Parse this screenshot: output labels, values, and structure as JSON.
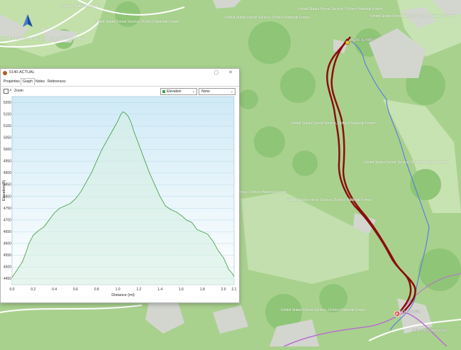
{
  "map": {
    "labels": [
      "United States Forest Service, Ochoco National Forest",
      "United States Forest Service, Ochoco National Forest",
      "United States Forest Service, Ochoco National Forest",
      "United States Forest Service, Ochoco National Forest",
      "United States Forest Service, Ochoco National Forest",
      "United States Forest Service, Ochoco National Forest",
      "United States Forest Service, Ochoco National Forest",
      "United States Forest Service, Ochoco National Forest",
      "ervice, Ochoco National Forest",
      "United States Forest Service, Ochoco National Forest",
      "Ochoco National Forest",
      "United States Forest Service, Ochoco National Forest"
    ],
    "waypoint_summit": "5140-SUMMIT",
    "waypoint_park": "5140-PARK",
    "road_label": "Little Hay Creek Road",
    "colors": {
      "land": "#a9d18e",
      "dark_land": "#8cc275",
      "clearing": "#d2d4cf",
      "track": "#8b0d0d",
      "river": "#5b82d8",
      "road": "#b86fd0"
    }
  },
  "window": {
    "title": "5140-ACTUAL",
    "tabs": [
      "Properties",
      "Graph",
      "Notes",
      "References"
    ],
    "active_tab": "Graph",
    "zoom_label": "Zoom",
    "dropdown_series": "Elevation",
    "dropdown_second": "None"
  },
  "chart_data": {
    "type": "area",
    "xlabel": "Distance  (mi)",
    "ylabel": "Elevation(ft)",
    "xlim": [
      0.0,
      2.1
    ],
    "ylim": [
      4425,
      5225
    ],
    "xticks": [
      "0.0",
      "0.2",
      "0.4",
      "0.6",
      "0.8",
      "1.0",
      "1.2",
      "1.4",
      "1.6",
      "1.8",
      "2.0",
      "2.1"
    ],
    "yticks": [
      "4450",
      "4500",
      "4550",
      "4600",
      "4650",
      "4700",
      "4750",
      "4800",
      "4850",
      "4900",
      "4950",
      "5000",
      "5050",
      "5100",
      "5150",
      "5200"
    ],
    "x": [
      0.0,
      0.02,
      0.05,
      0.08,
      0.1,
      0.13,
      0.16,
      0.2,
      0.25,
      0.3,
      0.35,
      0.4,
      0.45,
      0.5,
      0.55,
      0.6,
      0.65,
      0.7,
      0.75,
      0.8,
      0.85,
      0.9,
      0.95,
      1.0,
      1.03,
      1.05,
      1.07,
      1.1,
      1.13,
      1.15,
      1.2,
      1.25,
      1.3,
      1.35,
      1.4,
      1.45,
      1.5,
      1.55,
      1.6,
      1.65,
      1.7,
      1.75,
      1.8,
      1.85,
      1.9,
      1.95,
      2.0,
      2.05,
      2.08,
      2.1
    ],
    "y": [
      4455,
      4470,
      4490,
      4510,
      4525,
      4560,
      4600,
      4635,
      4655,
      4670,
      4700,
      4730,
      4750,
      4760,
      4770,
      4790,
      4820,
      4860,
      4900,
      4950,
      5000,
      5040,
      5080,
      5120,
      5150,
      5160,
      5155,
      5140,
      5110,
      5080,
      5020,
      4960,
      4900,
      4850,
      4800,
      4760,
      4745,
      4735,
      4720,
      4700,
      4690,
      4660,
      4650,
      4640,
      4610,
      4570,
      4540,
      4490,
      4475,
      4460
    ],
    "line_color": "#3a9a3c",
    "fill_color": "#d6efe2",
    "grid": true
  }
}
